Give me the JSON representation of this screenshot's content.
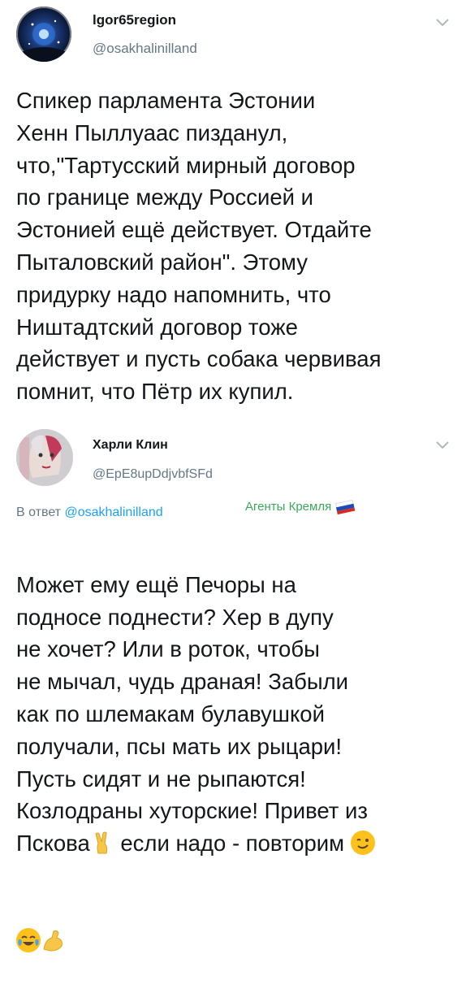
{
  "tweets": [
    {
      "author": {
        "name": "lgor65region",
        "handle": "@osakhalinilland",
        "avatar_icon": "night-sky-avatar-icon"
      },
      "text": "Спикер парламента Эстонии\nХенн Пыллуаас пизданул,\nчто,\"Тартусский мирный договор\nпо границе между Россией и\nЭстонией ещё действует. Отдайте\nПыталовский район\". Этому\nпридурку надо напомнить, что\nНиштадтский договор тоже\nдействует и пусть собака червивая\nпомнит, что Пётр их купил.",
      "menu_icon": "chevron-down-icon"
    },
    {
      "author": {
        "name": "Харли Клин",
        "handle": "@EpE8upDdjvbfSFd",
        "avatar_icon": "harley-avatar-icon"
      },
      "reply_prefix": "В ответ",
      "reply_to": "@osakhalinilland",
      "tag": "Агенты Кремля",
      "tag_icon": "russia-flag-icon",
      "text": "Может ему ещё Печоры на\nподносе поднести? Хер в дупу\nне хочет? Или в роток, чтобы\nне мычал, чудь драная! Забыли\nкак по шлемакам булавушкой\nполучали, псы мать их рыцари!\nПусть сидят и не рыпаются!\nКозлодраны хуторские! Привет из",
      "last_line_a": "Пскова",
      "last_line_b": " если надо - повторим",
      "emojis": [
        "victory-hand-icon",
        "winking-face-icon",
        "tears-of-joy-icon",
        "flexed-biceps-icon"
      ],
      "menu_icon": "chevron-down-icon"
    }
  ],
  "colors": {
    "text": "#14171a",
    "secondary": "#657786",
    "link": "#1da1f2",
    "tag": "#3ba95c"
  }
}
